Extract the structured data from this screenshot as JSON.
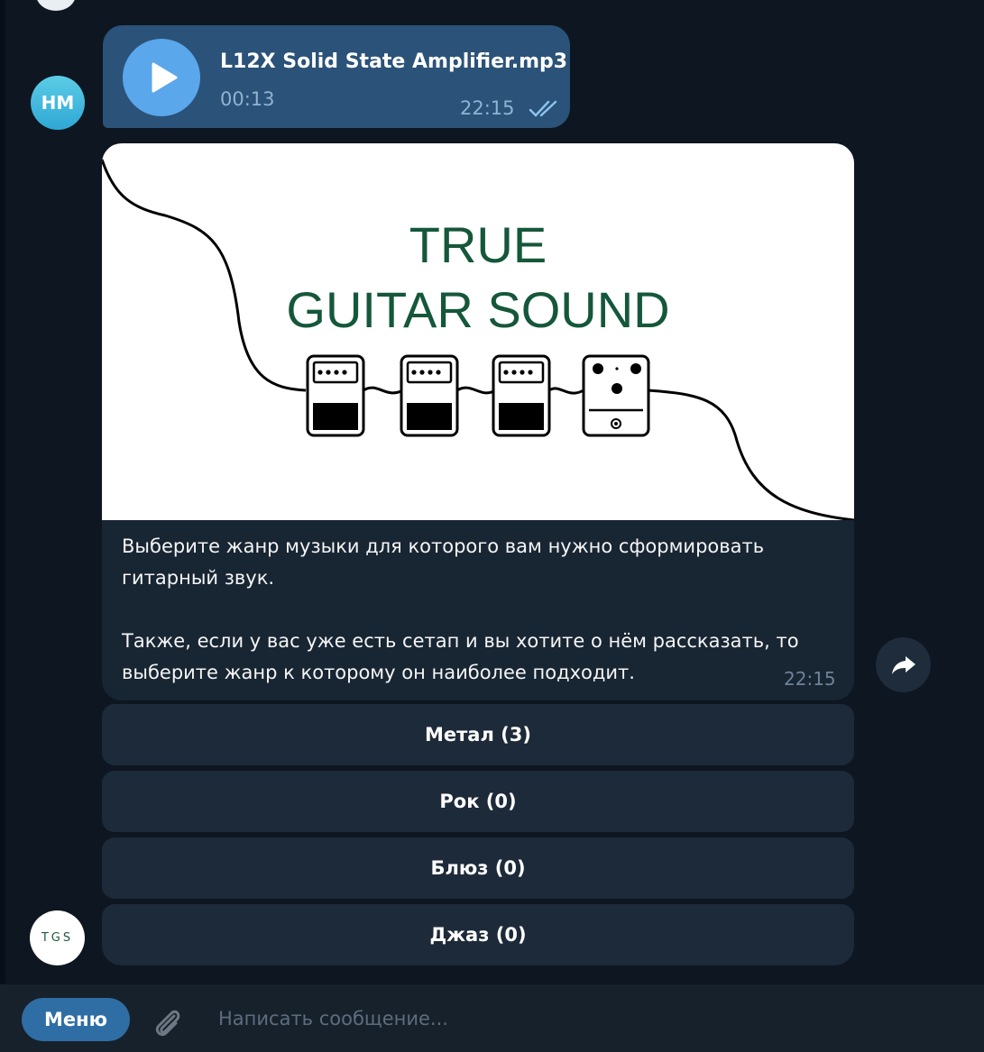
{
  "colors": {
    "background": "#0e1621",
    "bubble_out": "#2b5278",
    "bubble_in": "#182533",
    "keyboard_button": "#1d2a39",
    "accent": "#5aa7ec",
    "logo_green": "#15573a"
  },
  "sender": {
    "avatar_initials": "HM"
  },
  "bot": {
    "avatar_text": "TGS"
  },
  "audio_message": {
    "title": "L12X Solid State Amplifier.mp3",
    "duration": "00:13",
    "time": "22:15",
    "play_icon": "play-icon",
    "status_icon": "double-check-icon"
  },
  "bot_message": {
    "image": {
      "title_line1": "TRUE",
      "title_line2": "GUITAR SOUND"
    },
    "text_paragraph1": "Выберите жанр музыки для которого вам нужно сформировать гитарный звук.",
    "text_paragraph2": "Также, если у вас уже есть сетап и вы хотите о нём рассказать, то выберите жанр к которому он наиболее подходит.",
    "time": "22:15",
    "forward_icon": "forward-icon"
  },
  "keyboard": [
    {
      "label": "Метал (3)"
    },
    {
      "label": "Рок (0)"
    },
    {
      "label": "Блюз (0)"
    },
    {
      "label": "Джаз (0)"
    }
  ],
  "composer": {
    "menu_label": "Меню",
    "attach_icon": "paperclip-icon",
    "placeholder": "Написать сообщение..."
  }
}
